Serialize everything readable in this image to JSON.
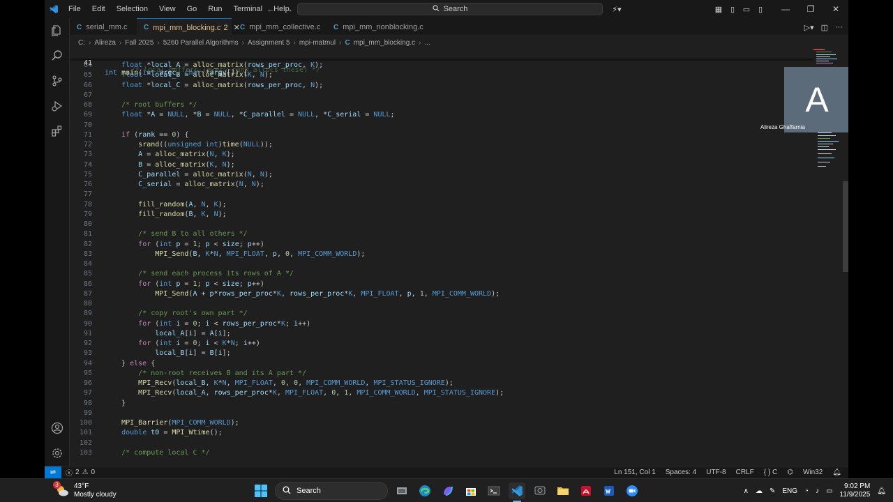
{
  "titlebar": {
    "menu": [
      "File",
      "Edit",
      "Selection",
      "View",
      "Go",
      "Run",
      "Terminal",
      "Help"
    ],
    "search_label": "Search"
  },
  "tabs": [
    {
      "name": "serial_mm.c",
      "modified": ""
    },
    {
      "name": "mpi_mm_blocking.c",
      "modified": "2"
    },
    {
      "name": "mpi_mm_collective.c",
      "modified": ""
    },
    {
      "name": "mpi_mm_nonblocking.c",
      "modified": ""
    }
  ],
  "breadcrumb": [
    "C:",
    "Alireza",
    "Fall 2025",
    "5260 Parallel Algorithms",
    "Assignment 5",
    "mpi-matmul",
    "mpi_mm_blocking.c",
    "..."
  ],
  "editor": {
    "sticky": {
      "num": "41",
      "code": "int main(int argc, char *argv[]) {"
    },
    "partial_comment": "/* local buffers (every rank allocs these) */",
    "lines": [
      {
        "num": "64",
        "code": "    float *local_A = alloc_matrix(rows_per_proc, K);"
      },
      {
        "num": "65",
        "code": "    float *local_B = alloc_matrix(K, N);"
      },
      {
        "num": "66",
        "code": "    float *local_C = alloc_matrix(rows_per_proc, N);"
      },
      {
        "num": "67",
        "code": ""
      },
      {
        "num": "68",
        "code": "    /* root buffers */"
      },
      {
        "num": "69",
        "code": "    float *A = NULL, *B = NULL, *C_parallel = NULL, *C_serial = NULL;"
      },
      {
        "num": "70",
        "code": ""
      },
      {
        "num": "71",
        "code": "    if (rank == 0) {"
      },
      {
        "num": "72",
        "code": "        srand((unsigned int)time(NULL));"
      },
      {
        "num": "73",
        "code": "        A = alloc_matrix(N, K);"
      },
      {
        "num": "74",
        "code": "        B = alloc_matrix(K, N);"
      },
      {
        "num": "75",
        "code": "        C_parallel = alloc_matrix(N, N);"
      },
      {
        "num": "76",
        "code": "        C_serial = alloc_matrix(N, N);"
      },
      {
        "num": "77",
        "code": ""
      },
      {
        "num": "78",
        "code": "        fill_random(A, N, K);"
      },
      {
        "num": "79",
        "code": "        fill_random(B, K, N);"
      },
      {
        "num": "80",
        "code": ""
      },
      {
        "num": "81",
        "code": "        /* send B to all others */"
      },
      {
        "num": "82",
        "code": "        for (int p = 1; p < size; p++)"
      },
      {
        "num": "83",
        "code": "            MPI_Send(B, K*N, MPI_FLOAT, p, 0, MPI_COMM_WORLD);"
      },
      {
        "num": "84",
        "code": ""
      },
      {
        "num": "85",
        "code": "        /* send each process its rows of A */"
      },
      {
        "num": "86",
        "code": "        for (int p = 1; p < size; p++)"
      },
      {
        "num": "87",
        "code": "            MPI_Send(A + p*rows_per_proc*K, rows_per_proc*K, MPI_FLOAT, p, 1, MPI_COMM_WORLD);"
      },
      {
        "num": "88",
        "code": ""
      },
      {
        "num": "89",
        "code": "        /* copy root's own part */"
      },
      {
        "num": "90",
        "code": "        for (int i = 0; i < rows_per_proc*K; i++)"
      },
      {
        "num": "91",
        "code": "            local_A[i] = A[i];"
      },
      {
        "num": "92",
        "code": "        for (int i = 0; i < K*N; i++)"
      },
      {
        "num": "93",
        "code": "            local_B[i] = B[i];"
      },
      {
        "num": "94",
        "code": "    } else {"
      },
      {
        "num": "95",
        "code": "        /* non-root receives B and its A part */"
      },
      {
        "num": "96",
        "code": "        MPI_Recv(local_B, K*N, MPI_FLOAT, 0, 0, MPI_COMM_WORLD, MPI_STATUS_IGNORE);"
      },
      {
        "num": "97",
        "code": "        MPI_Recv(local_A, rows_per_proc*K, MPI_FLOAT, 0, 1, MPI_COMM_WORLD, MPI_STATUS_IGNORE);"
      },
      {
        "num": "98",
        "code": "    }"
      },
      {
        "num": "99",
        "code": ""
      },
      {
        "num": "100",
        "code": "    MPI_Barrier(MPI_COMM_WORLD);"
      },
      {
        "num": "101",
        "code": "    double t0 = MPI_Wtime();"
      },
      {
        "num": "102",
        "code": ""
      },
      {
        "num": "103",
        "code": "    /* compute local C */"
      }
    ]
  },
  "video": {
    "initial": "A",
    "name": "Alireza Ghaffarnia"
  },
  "statusbar": {
    "problems": "2",
    "warnings": "0",
    "position": "Ln 151, Col 1",
    "spaces": "Spaces: 4",
    "encoding": "UTF-8",
    "eol": "CRLF",
    "language": "C",
    "platform": "Win32"
  },
  "taskbar": {
    "temperature": "43°F",
    "weather": "Mostly cloudy",
    "weather_badge": "3",
    "search_label": "Search",
    "language": "ENG",
    "time": "9:02 PM",
    "date": "11/9/2025"
  },
  "colors": {
    "accent": "#0078d4",
    "editor_bg": "#1f1f1f",
    "keyword": "#569cd6",
    "function": "#dcdcaa",
    "number": "#b5cea8",
    "comment": "#6a9955"
  }
}
